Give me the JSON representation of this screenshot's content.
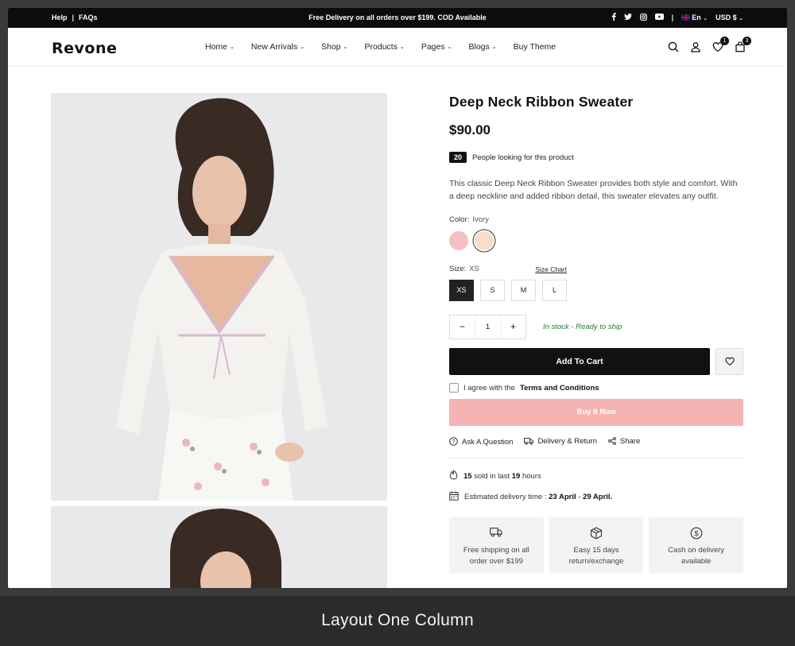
{
  "topbar": {
    "help": "Help",
    "sep": "|",
    "faqs": "FAQs",
    "promo": "Free Delivery on all orders over $199. COD Available",
    "language": "En",
    "currency": "USD $"
  },
  "header": {
    "logo": "Revone",
    "nav": [
      "Home",
      "New Arrivals",
      "Shop",
      "Products",
      "Pages",
      "Blogs",
      "Buy Theme"
    ],
    "wishlist_count": "1",
    "cart_count": "3"
  },
  "product": {
    "title": "Deep Neck Ribbon Sweater",
    "price": "$90.00",
    "viewers_count": "20",
    "viewers_text": "People looking for this product",
    "description": "This classic Deep Neck Ribbon Sweater provides both style and comfort. With a deep neckline and added ribbon detail, this sweater elevates any outfit.",
    "color_label": "Color:",
    "color_value": "Ivory",
    "colors": [
      "#f6bfc8",
      "#f8ddcc"
    ],
    "size_label": "Size:",
    "size_value": "XS",
    "size_chart": "Size Chart",
    "sizes": [
      "XS",
      "S",
      "M",
      "L"
    ],
    "quantity": "1",
    "minus": "−",
    "plus": "+",
    "stock": "In stock - Ready to ship",
    "add_to_cart": "Add To Cart",
    "terms_prefix": "I agree with the",
    "terms_link": "Terms and Conditions",
    "buy_now": "Buy It Now",
    "ask": "Ask A Question",
    "delivery": "Delivery & Return",
    "share": "Share",
    "sold_count": "15",
    "sold_text": "sold in last",
    "sold_hours": "19",
    "hours_text": "hours",
    "eta_label": "Estimated delivery time :",
    "eta_from": "23 April",
    "eta_dash": "-",
    "eta_to": "29 April."
  },
  "features": [
    {
      "line1": "Free shipping on all",
      "line2": "order over $199"
    },
    {
      "line1": "Easy 15 days",
      "line2": "return/exchange"
    },
    {
      "line1": "Cash on delivery",
      "line2": "available"
    }
  ],
  "caption": "Layout One Column",
  "colors": {
    "accent_pink": "#f5b4b4",
    "stock_green": "#1f7a3a",
    "dark": "#111111"
  }
}
